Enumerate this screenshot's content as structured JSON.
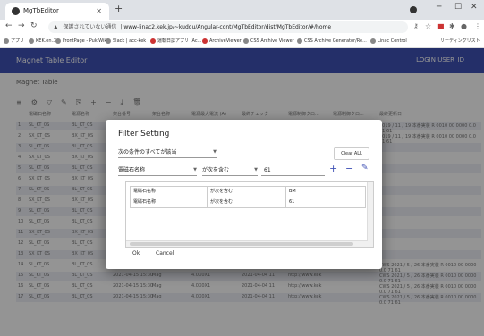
{
  "browser": {
    "tab_title": "MgTbEditor",
    "insecure_label": "保護されていない通信",
    "url": "www-linac2.kek.jp/~kudou/Angular-cont/MgTbEditor/dist/MgTbEditor/#/home",
    "bookmarks": [
      "アプリ",
      "KEK.en.ニ",
      "FrontPage - PukiWiki",
      "Slack | acc-kek",
      "運転日誌アプリ (Ac...",
      "ArchiveViewer",
      "CSS Archive Viewer",
      "CSS Archive Generator/Re...",
      "Linac Control"
    ],
    "reading_list": "リーディングリスト"
  },
  "app": {
    "title": "Magnet Table Editor",
    "user": "LOGIN USER_ID",
    "toolbar_text": "Magnet Table",
    "headers": [
      "電磁石名称",
      "電源名称",
      "架台番号",
      "架台名称",
      "電源最大電流 (A)",
      "最終チェック",
      "電源制御クロ...",
      "電源制御クロ...",
      "最終更新日"
    ],
    "rows": [
      [
        "1",
        "SL_KT_0S",
        "BL_KT_0S",
        "",
        "",
        "",
        "",
        "",
        "2019 / 11 / 19 本番実装 R 0010 00 0000 0.0 71 61"
      ],
      [
        "2",
        "SX_KT_0S",
        "BX_KT_0S",
        "",
        "",
        "",
        "",
        "",
        "2019 / 11 / 19 本番実装 R 0010 00 0000 0.0 71 61"
      ],
      [
        "3",
        "SL_KT_0S",
        "BL_KT_0S",
        "",
        "",
        "",
        "",
        "",
        ""
      ],
      [
        "4",
        "SX_KT_0S",
        "BX_KT_0S",
        "",
        "",
        "",
        "",
        "",
        ""
      ],
      [
        "5",
        "SL_KT_0S",
        "BL_KT_0S",
        "",
        "",
        "",
        "",
        "",
        ""
      ],
      [
        "6",
        "SX_KT_0S",
        "BX_KT_0S",
        "",
        "",
        "",
        "",
        "",
        ""
      ],
      [
        "7",
        "SL_KT_0S",
        "BL_KT_0S",
        "",
        "",
        "",
        "",
        "",
        ""
      ],
      [
        "8",
        "SX_KT_0S",
        "BX_KT_0S",
        "",
        "",
        "",
        "",
        "",
        ""
      ],
      [
        "9",
        "SL_KT_0S",
        "BL_KT_0S",
        "",
        "",
        "",
        "",
        "",
        ""
      ],
      [
        "10",
        "SL_KT_0S",
        "BL_KT_0S",
        "",
        "",
        "",
        "",
        "",
        ""
      ],
      [
        "11",
        "SX_KT_0S",
        "BX_KT_0S",
        "",
        "",
        "",
        "",
        "",
        ""
      ],
      [
        "12",
        "SL_KT_0S",
        "BL_KT_0S",
        "",
        "",
        "",
        "",
        "",
        ""
      ],
      [
        "13",
        "SX_KT_0S",
        "BX_KT_0S",
        "",
        "",
        "",
        "",
        "",
        ""
      ],
      [
        "14",
        "SL_KT_0S",
        "BL_KT_0S",
        "2021-04-15 15:30",
        "Mag",
        "4.0X0X0",
        "2021-04-04 11",
        "http://www.kek",
        "CWS 2021 / 5 / 26 本番実装 R 0010 00 0000 0.0 71 61"
      ],
      [
        "15",
        "SL_KT_0S",
        "BL_KT_0S",
        "2021-04-15 15:30",
        "Mag",
        "4.0X0X1",
        "2021-04-04 11",
        "http://www.kek",
        "CWS 2021 / 5 / 26 本番実装 R 0010 00 0000 0.0 71 61"
      ],
      [
        "16",
        "SL_KT_0S",
        "BL_KT_0S",
        "2021-04-15 15:30",
        "Mag",
        "4.0X0X1",
        "2021-04-04 11",
        "http://www.kek",
        "CWS 2021 / 5 / 26 本番実装 R 0010 00 0000 0.0 71 61"
      ],
      [
        "17",
        "SL_KT_0S",
        "BL_KT_0S",
        "2021-04-15 15:30",
        "Mag",
        "4.0X0X1",
        "2021-04-04 11",
        "http://www.kek",
        "CWS 2021 / 5 / 26 本番実装 R 0010 00 0000 0.0 71 61"
      ]
    ]
  },
  "dialog": {
    "title": "Filter Setting",
    "condition_mode": "次の条件のすべてが該当",
    "clear_all": "Clear ALL",
    "input_field": "電磁石名称",
    "input_op": "が次を含む",
    "input_value": "61",
    "table_rows": [
      {
        "field": "電磁石名称",
        "op": "が次を含む",
        "value": "BM"
      },
      {
        "field": "電磁石名称",
        "op": "が次を含む",
        "value": "61"
      }
    ],
    "ok": "Ok",
    "cancel": "Cancel"
  }
}
